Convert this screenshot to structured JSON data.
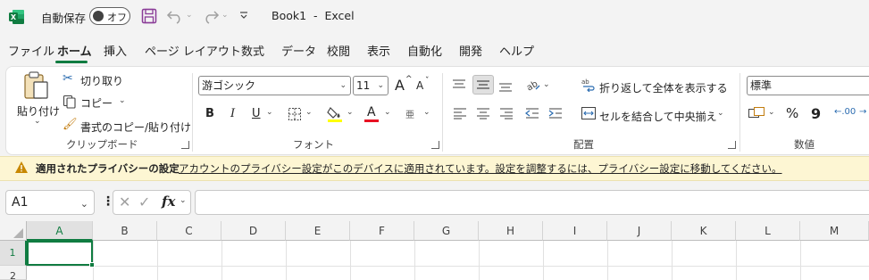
{
  "titlebar": {
    "autosave_label": "自動保存",
    "autosave_state": "オフ",
    "doc_title": "Book1  -  Excel"
  },
  "tabs": [
    "ファイル",
    "ホーム",
    "挿入",
    "ページ レイアウト",
    "数式",
    "データ",
    "校閲",
    "表示",
    "自動化",
    "開発",
    "ヘルプ"
  ],
  "active_tab": "ホーム",
  "ribbon": {
    "clipboard": {
      "paste_label": "貼り付け",
      "cut_label": "切り取り",
      "copy_label": "コピー",
      "format_painter_label": "書式のコピー/貼り付け",
      "group_label": "クリップボード"
    },
    "font": {
      "font_name": "游ゴシック",
      "font_size": "11",
      "group_label": "フォント",
      "bold": "B",
      "italic": "I",
      "underline": "U",
      "font_color_glyph": "A",
      "grow_glyph": "A",
      "shrink_glyph": "A",
      "phonetic_glyph": "亜",
      "highlight_color": "#ffff00",
      "font_color": "#e81123"
    },
    "alignment": {
      "wrap_text_label": "折り返して全体を表示する",
      "merge_center_label": "セルを結合して中央揃え",
      "group_label": "配置"
    },
    "number": {
      "format": "標準",
      "percent": "%",
      "comma": "9",
      "group_label": "数値"
    }
  },
  "privacy": {
    "title": "適用されたプライバシーの設定",
    "message": "アカウントのプライバシー設定がこのデバイスに適用されています。設定を調整するには、プライバシー設定に移動してください。"
  },
  "formula_bar": {
    "name_box": "A1",
    "fx_label": "fx",
    "value": ""
  },
  "grid": {
    "columns": [
      "A",
      "B",
      "C",
      "D",
      "E",
      "F",
      "G",
      "H",
      "I",
      "J",
      "K",
      "L",
      "M"
    ],
    "rows": [
      "1",
      "2"
    ],
    "selected_cell": "A1"
  },
  "colors": {
    "accent": "#107c41",
    "excel_icon": "#107c41",
    "save_icon": "#8a3b97"
  }
}
